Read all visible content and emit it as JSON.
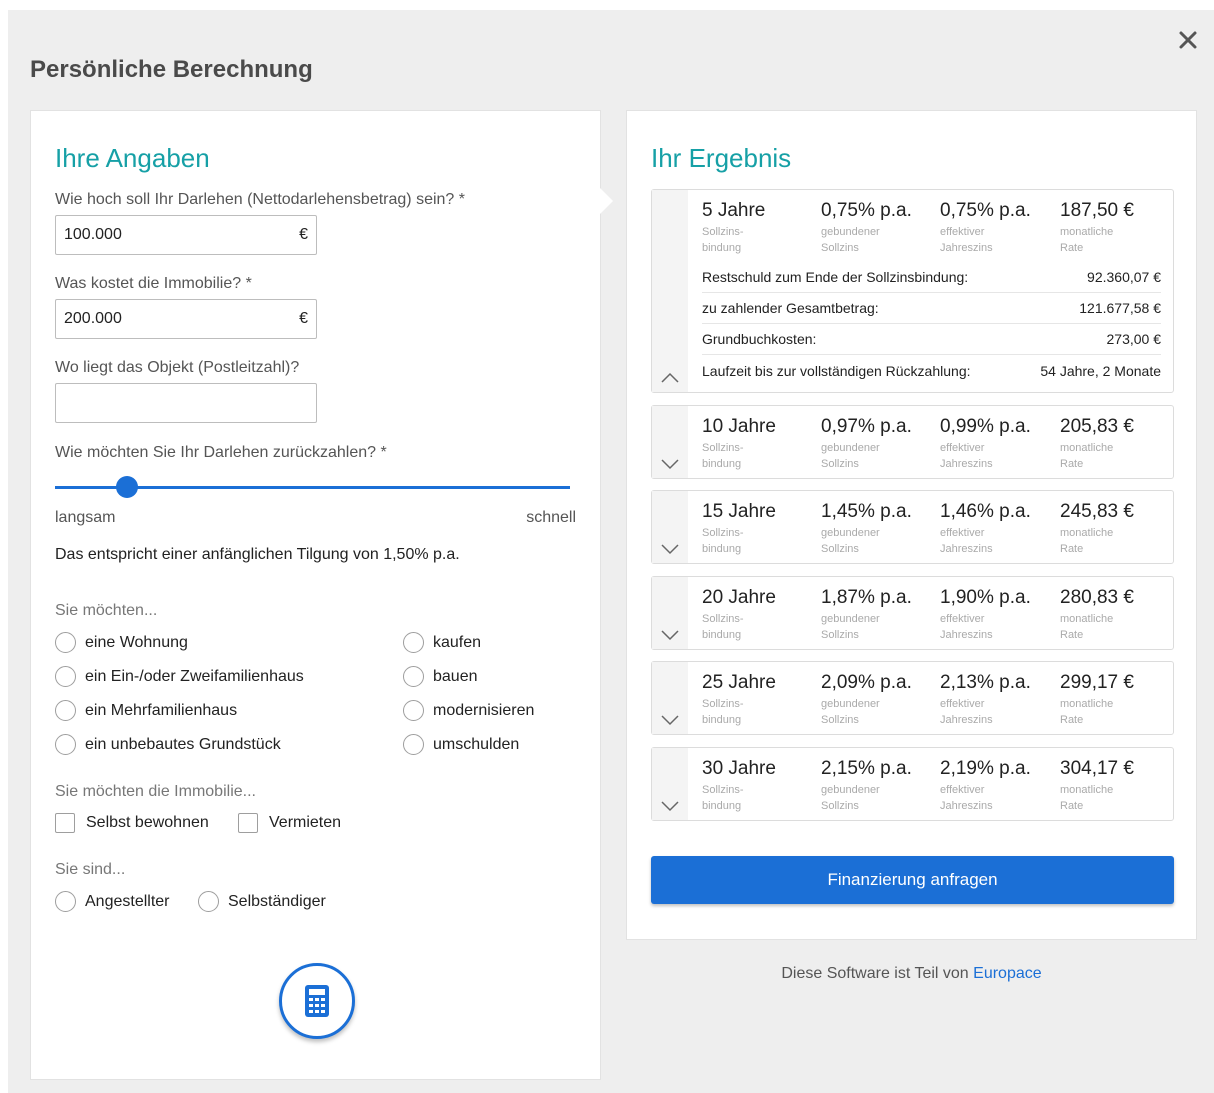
{
  "modal": {
    "title": "Persönliche Berechnung",
    "close_icon": "close-icon"
  },
  "form": {
    "heading": "Ihre Angaben",
    "loan_label": "Wie hoch soll Ihr Darlehen (Nettodarlehensbetrag) sein? *",
    "loan_value": "100.000",
    "currency": "€",
    "price_label": "Was kostet die Immobilie? *",
    "price_value": "200.000",
    "zip_label": "Wo liegt das Objekt (Postleitzahl)?",
    "zip_value": "",
    "repay_label": "Wie möchten Sie Ihr Darlehen zurückzahlen? *",
    "repay_slider_level": 0.14,
    "slow_label": "langsam",
    "fast_label": "schnell",
    "tilgung_text": "Das entspricht einer anfänglichen Tilgung von 1,50% p.a.",
    "want_label": "Sie möchten...",
    "property_types": [
      "eine Wohnung",
      "ein Ein-/oder Zweifamilienhaus",
      "ein Mehrfamilienhaus",
      "ein unbebautes Grundstück"
    ],
    "actions": [
      "kaufen",
      "bauen",
      "modernisieren",
      "umschulden"
    ],
    "usage_label": "Sie möchten die Immobilie...",
    "usage_options": [
      "Selbst bewohnen",
      "Vermieten"
    ],
    "employment_label": "Sie sind...",
    "employment_options": [
      "Angestellter",
      "Selbständiger"
    ],
    "calc_icon": "calculator-icon"
  },
  "result": {
    "heading": "Ihr Ergebnis",
    "sub_labels": {
      "years_1": "Sollzins-",
      "years_2": "bindung",
      "rate_1": "gebundener",
      "rate_2": "Sollzins",
      "eff_1": "effektiver",
      "eff_2": "Jahreszins",
      "pay_1": "monatliche",
      "pay_2": "Rate"
    },
    "offers": [
      {
        "years": "5 Jahre",
        "rate": "0,75% p.a.",
        "effective": "0,75% p.a.",
        "monthly": "187,50 €",
        "expanded": true
      },
      {
        "years": "10 Jahre",
        "rate": "0,97% p.a.",
        "effective": "0,99% p.a.",
        "monthly": "205,83 €",
        "expanded": false
      },
      {
        "years": "15 Jahre",
        "rate": "1,45% p.a.",
        "effective": "1,46% p.a.",
        "monthly": "245,83 €",
        "expanded": false
      },
      {
        "years": "20 Jahre",
        "rate": "1,87% p.a.",
        "effective": "1,90% p.a.",
        "monthly": "280,83 €",
        "expanded": false
      },
      {
        "years": "25 Jahre",
        "rate": "2,09% p.a.",
        "effective": "2,13% p.a.",
        "monthly": "299,17 €",
        "expanded": false
      },
      {
        "years": "30 Jahre",
        "rate": "2,15% p.a.",
        "effective": "2,19% p.a.",
        "monthly": "304,17 €",
        "expanded": false
      }
    ],
    "details": [
      {
        "label": "Restschuld zum Ende der Sollzinsbindung:",
        "value": "92.360,07 €"
      },
      {
        "label": "zu zahlender Gesamtbetrag:",
        "value": "121.677,58 €"
      },
      {
        "label": "Grundbuchkosten:",
        "value": "273,00 €"
      },
      {
        "label": "Laufzeit bis zur vollständigen Rückzahlung:",
        "value": "54 Jahre, 2 Monate"
      }
    ],
    "cta_label": "Finanzierung anfragen"
  },
  "footer": {
    "text": "Diese Software ist Teil von",
    "link": "Europace"
  },
  "colors": {
    "accent_teal": "#16a0a6",
    "primary_blue": "#1b6fd6"
  }
}
